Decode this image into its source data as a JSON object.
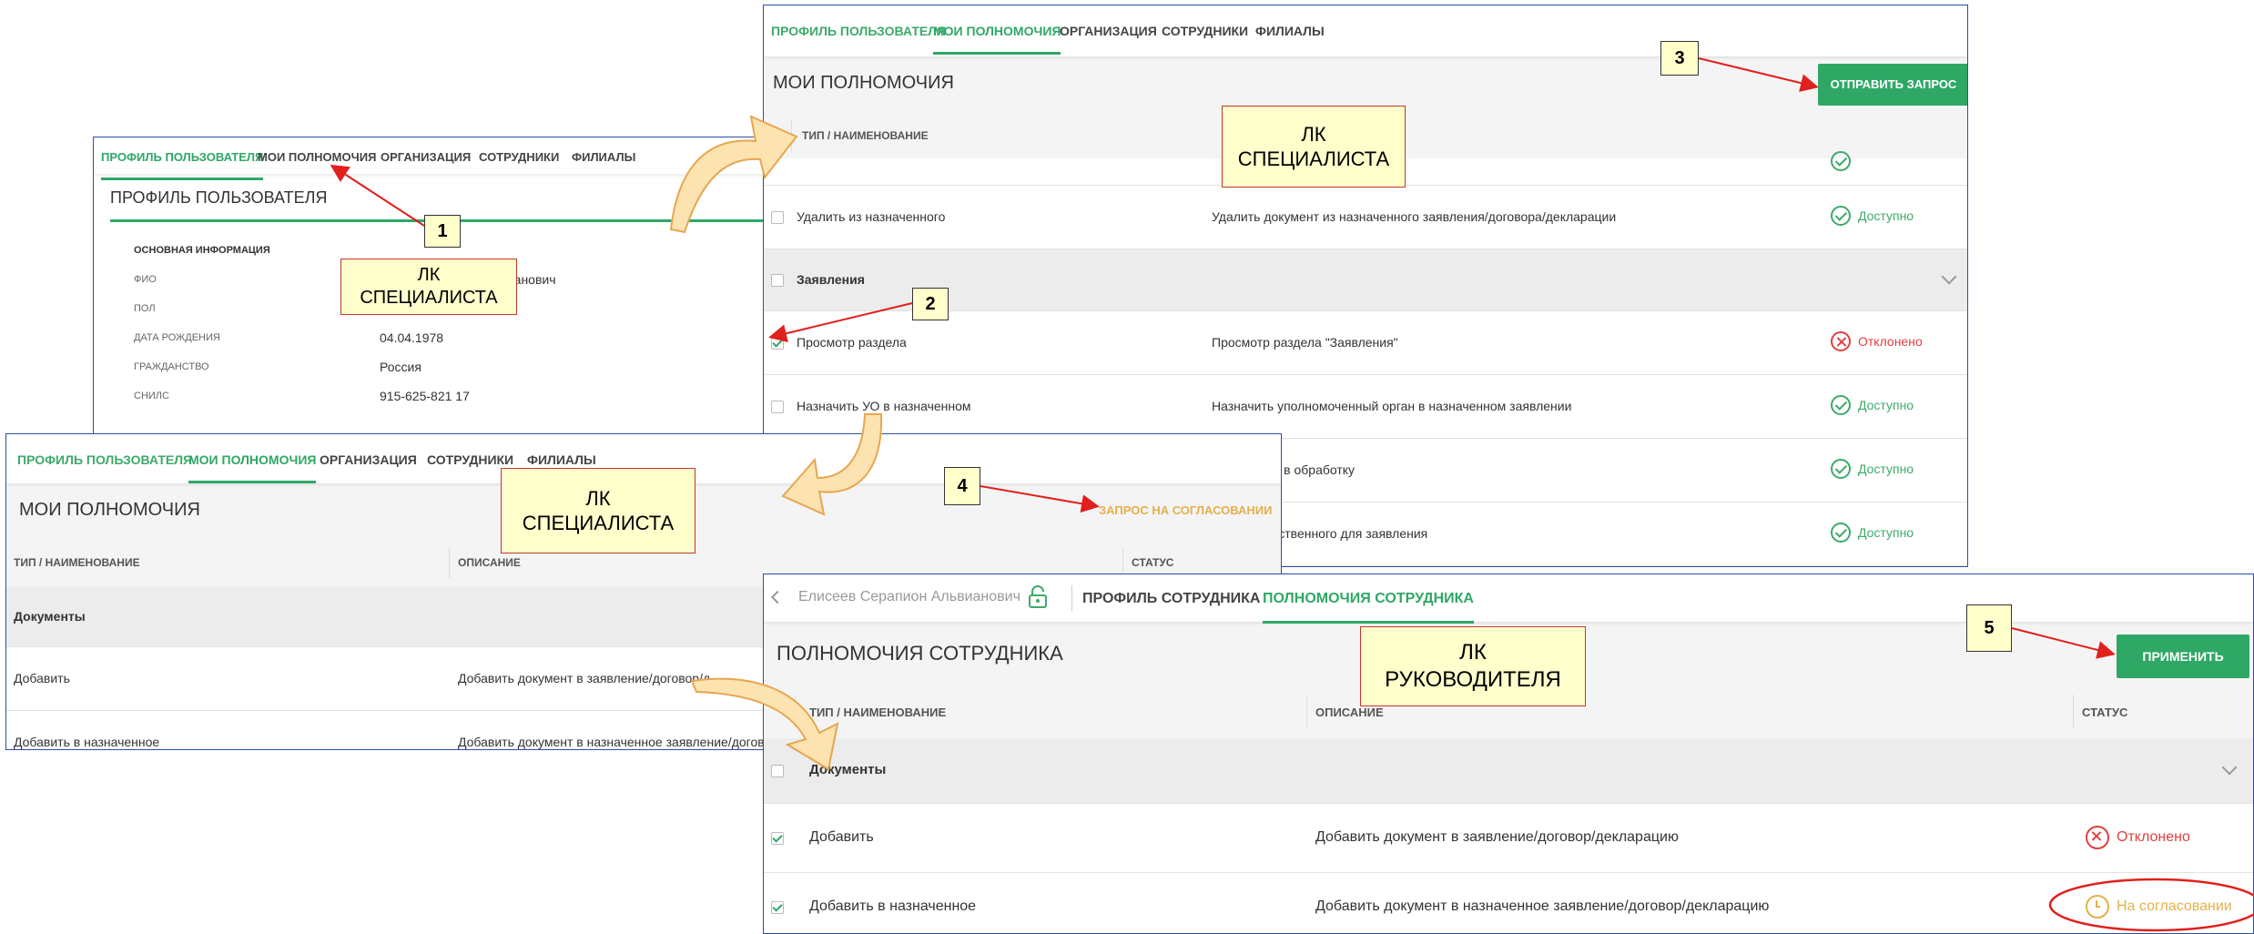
{
  "profile_panel": {
    "tabs": [
      "ПРОФИЛЬ ПОЛЬЗОВАТЕЛЯ",
      "МОИ ПОЛНОМОЧИЯ",
      "ОРГАНИЗАЦИЯ",
      "СОТРУДНИКИ",
      "ФИЛИАЛЫ"
    ],
    "title": "ПРОФИЛЬ ПОЛЬЗОВАТЕЛЯ",
    "section": "ОСНОВНАЯ ИНФОРМАЦИЯ",
    "fields": [
      {
        "label": "ФИО",
        "value": "...анович"
      },
      {
        "label": "ПОЛ",
        "value": ""
      },
      {
        "label": "ДАТА РОЖДЕНИЯ",
        "value": "04.04.1978"
      },
      {
        "label": "ГРАЖДАНСТВО",
        "value": "Россия"
      },
      {
        "label": "СНИЛС",
        "value": "915-625-821 17"
      }
    ]
  },
  "top_right_panel": {
    "tabs": [
      "ПРОФИЛЬ ПОЛЬЗОВАТЕЛЯ",
      "МОИ ПОЛНОМОЧИЯ",
      "ОРГАНИЗАЦИЯ",
      "СОТРУДНИКИ",
      "ФИЛИАЛЫ"
    ],
    "title": "МОИ ПОЛНОМОЧИЯ",
    "send_button": "ОТПРАВИТЬ ЗАПРОС",
    "col_type": "ТИП / НАИМЕНОВАНИЕ",
    "rows": [
      {
        "name": "Удалить из назначенного",
        "desc": "Удалить документ из назначенного заявления/договора/декларации",
        "status": "Доступно"
      },
      {
        "name": "Заявления",
        "desc": "",
        "status": ""
      },
      {
        "name": "Просмотр раздела",
        "desc": "Просмотр раздела \"Заявления\"",
        "status": "Отклонено"
      },
      {
        "name": "Назначить УО в назначенном",
        "desc": "Назначить уполномоченный орган в назначенном заявлении",
        "status": "Доступно"
      },
      {
        "name": "",
        "desc": "...ие в обработку",
        "status": "Доступно"
      },
      {
        "name": "",
        "desc": "...етственного для заявления",
        "status": "Доступно"
      }
    ]
  },
  "middle_panel": {
    "tabs": [
      "ПРОФИЛЬ ПОЛЬЗОВАТЕЛЯ",
      "МОИ ПОЛНОМОЧИЯ",
      "ОРГАНИЗАЦИЯ",
      "СОТРУДНИКИ",
      "ФИЛИАЛЫ"
    ],
    "title": "МОИ ПОЛНОМОЧИЯ",
    "request_status": "ЗАПРОС НА СОГЛАСОВАНИИ",
    "col_type": "ТИП / НАИМЕНОВАНИЕ",
    "col_desc": "ОПИСАНИЕ",
    "col_status": "СТАТУС",
    "rows": [
      {
        "name": "Документы",
        "desc": ""
      },
      {
        "name": "Добавить",
        "desc": "Добавить документ в заявление/договор/д..."
      },
      {
        "name": "Добавить в назначенное",
        "desc": "Добавить документ в назначенное заявление/договор..."
      }
    ]
  },
  "bottom_panel": {
    "employee": "Елисеев Серапион Альвианович",
    "tabs": [
      "ПРОФИЛЬ СОТРУДНИКА",
      "ПОЛНОМОЧИЯ СОТРУДНИКА"
    ],
    "title": "ПОЛНОМОЧИЯ СОТРУДНИКА",
    "apply_button": "ПРИМЕНИТЬ",
    "col_type": "ТИП / НАИМЕНОВАНИЕ",
    "col_desc": "ОПИСАНИЕ",
    "col_status": "СТАТУС",
    "rows": [
      {
        "name": "Документы",
        "desc": "",
        "status": ""
      },
      {
        "name": "Добавить",
        "desc": "Добавить документ в заявление/договор/декларацию",
        "status": "Отклонено"
      },
      {
        "name": "Добавить в назначенное",
        "desc": "Добавить документ в назначенное заявление/договор/декларацию",
        "status": "На согласовании"
      }
    ]
  },
  "callouts": {
    "lk_specialist_1": [
      "ЛК",
      "СПЕЦИАЛИСТА"
    ],
    "lk_specialist_2": [
      "ЛК",
      "СПЕЦИАЛИСТА"
    ],
    "lk_specialist_3": [
      "ЛК",
      "СПЕЦИАЛИСТА"
    ],
    "lk_manager": [
      "ЛК",
      "РУКОВОДИТЕЛЯ"
    ]
  },
  "steps": [
    "1",
    "2",
    "3",
    "4",
    "5"
  ],
  "colors": {
    "accent": "#2fa866",
    "frame": "#2b4fa3",
    "arrow": "#e0201c",
    "warn": "#e4b04a",
    "error": "#e0403f"
  }
}
